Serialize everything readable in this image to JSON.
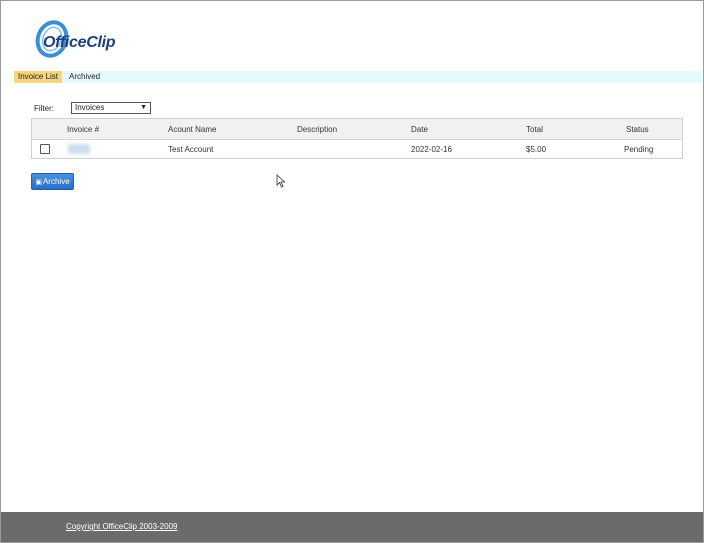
{
  "brand": {
    "name": "OfficeClip"
  },
  "tabs": [
    {
      "label": "Invoice List",
      "active": true
    },
    {
      "label": "Archived",
      "active": false
    }
  ],
  "filter": {
    "label": "Filter:",
    "selected": "Invoices"
  },
  "table": {
    "headers": [
      "Invoice #",
      "Acount Name",
      "Description",
      "Date",
      "Total",
      "Status"
    ],
    "rows": [
      {
        "invoice": "",
        "account": "Test Account",
        "description": "",
        "date": "2022-02-16",
        "total": "$5.00",
        "status": "Pending"
      }
    ]
  },
  "actions": {
    "archive_label": "Archive"
  },
  "footer": {
    "copyright": "Copyright OfficeClip 2003-2009"
  },
  "colors": {
    "tab_active_bg": "#f7d67a",
    "tabbar_bg": "#e4fafd",
    "button_bg": "#2a6fc7",
    "footer_bg": "#6b6b6b"
  }
}
